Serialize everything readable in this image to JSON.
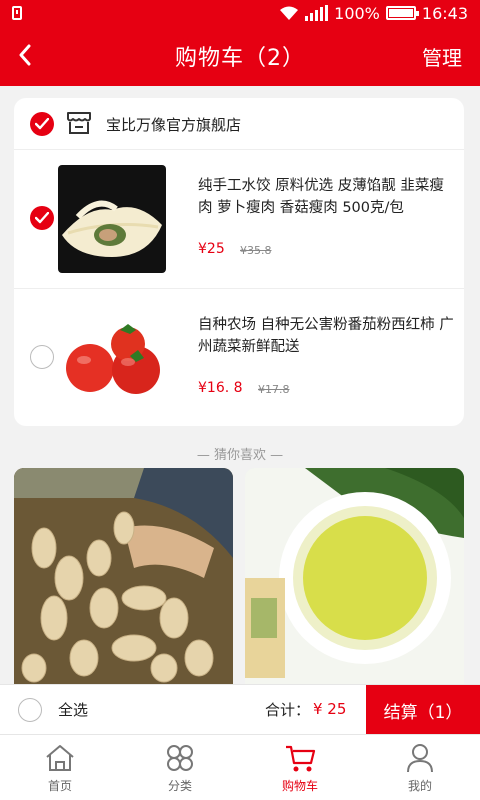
{
  "status_bar": {
    "battery": "100%",
    "time": "16:43"
  },
  "navbar": {
    "title": "购物车（2）",
    "manage": "管理"
  },
  "shop": {
    "name": "宝比万像官方旗舰店"
  },
  "items": [
    {
      "title": "纯手工水饺 原料优选 皮薄馅靓 韭菜瘦肉 萝卜瘦肉 香菇瘦肉 500克/包",
      "price": "¥25",
      "old_price": "¥35.8",
      "selected": true
    },
    {
      "title": "自种农场 自种无公害粉番茄粉西红柿 广州蔬菜新鲜配送",
      "price": "¥16. 8",
      "old_price": "¥17.8",
      "selected": false
    }
  ],
  "recommend_label": "— 猜你喜欢 —",
  "checkout": {
    "select_all": "全选",
    "total_label": "合计：",
    "total_value": "¥ 25",
    "settle": "结算（1）"
  },
  "tabs": [
    {
      "label": "首页",
      "icon": "home-icon"
    },
    {
      "label": "分类",
      "icon": "category-icon"
    },
    {
      "label": "购物车",
      "icon": "cart-icon"
    },
    {
      "label": "我的",
      "icon": "user-icon"
    }
  ],
  "colors": {
    "accent": "#e60012",
    "background": "#f2f2f2"
  }
}
